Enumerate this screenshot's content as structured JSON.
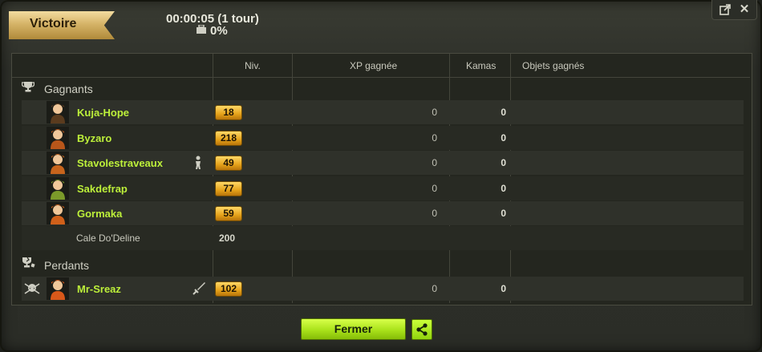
{
  "header": {
    "result_label": "Victoire",
    "duration": "00:00:05 (1 tour)",
    "percent": "0%"
  },
  "columns": {
    "level": "Niv.",
    "xp": "XP gagnée",
    "kamas": "Kamas",
    "items": "Objets gagnés"
  },
  "winners_title": "Gagnants",
  "losers_title": "Perdants",
  "winners": [
    {
      "name": "Kuja-Hope",
      "level": "18",
      "xp": "0",
      "kamas": "0",
      "avatar_color": "#5a3b1e"
    },
    {
      "name": "Byzaro",
      "level": "218",
      "xp": "0",
      "kamas": "0",
      "avatar_color": "#b8561a"
    },
    {
      "name": "Stavolestraveaux",
      "level": "49",
      "xp": "0",
      "kamas": "0",
      "avatar_color": "#c7641c"
    },
    {
      "name": "Sakdefrap",
      "level": "77",
      "xp": "0",
      "kamas": "0",
      "avatar_color": "#7b9a2a"
    },
    {
      "name": "Gormaka",
      "level": "59",
      "xp": "0",
      "kamas": "0",
      "avatar_color": "#d0601a"
    }
  ],
  "winner_monster": {
    "name": "Cale Do'Deline",
    "level": "200"
  },
  "losers": [
    {
      "name": "Mr-Sreaz",
      "level": "102",
      "xp": "0",
      "kamas": "0",
      "avatar_color": "#d8581a"
    }
  ],
  "footer": {
    "close_label": "Fermer"
  },
  "colors": {
    "name_green": "#bdf03a",
    "button_green": "#a9e21a",
    "level_gold": "#e5a21a"
  }
}
